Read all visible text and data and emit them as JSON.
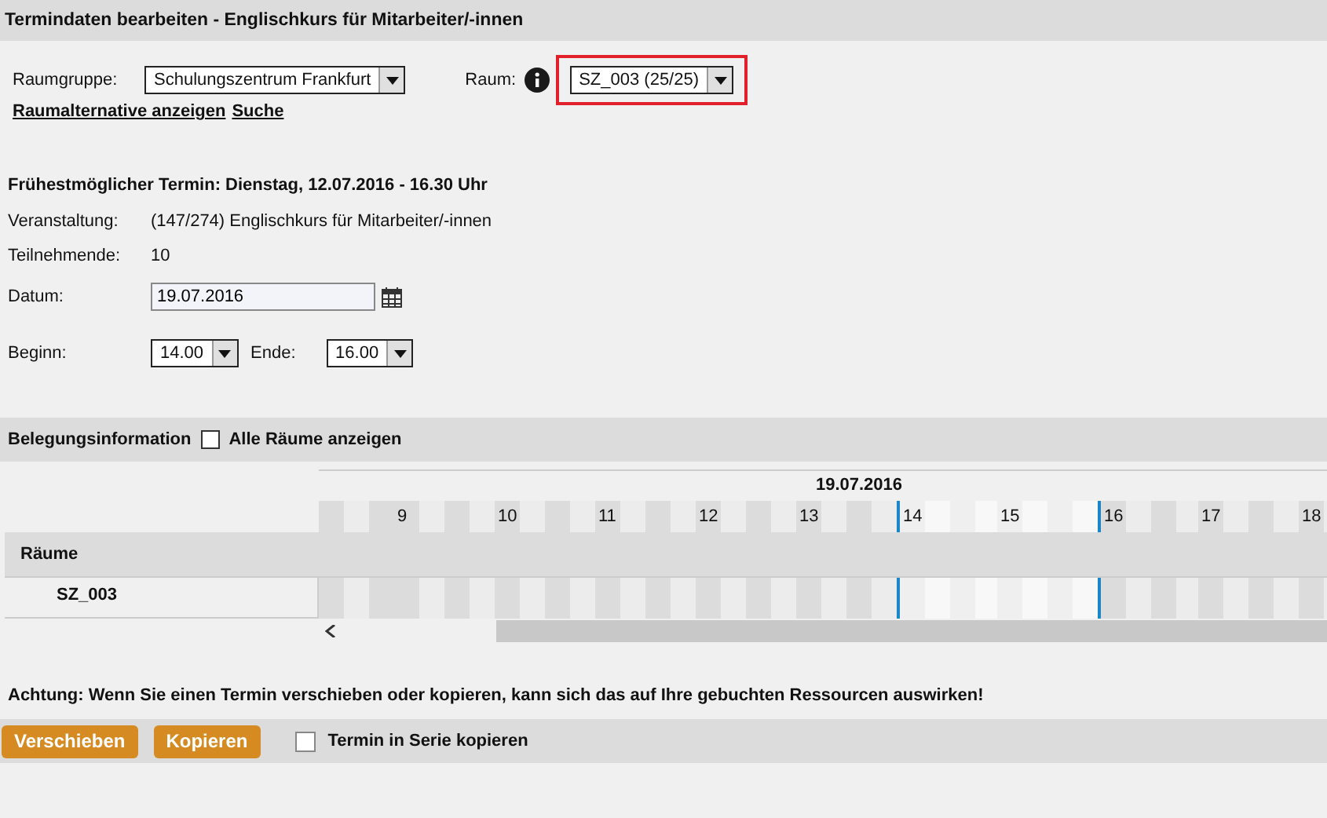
{
  "window": {
    "title": "Termindaten bearbeiten - Englischkurs für Mitarbeiter/-innen"
  },
  "room_group": {
    "label": "Raumgruppe:",
    "value": "Schulungszentrum Frankfurt"
  },
  "room": {
    "label": "Raum:",
    "value": "SZ_003 (25/25)",
    "highlighted": true
  },
  "links": [
    "Raumalternative anzeigen",
    "Suche"
  ],
  "earliest": "Frühestmöglicher Termin: Dienstag, 12.07.2016 - 16.30 Uhr",
  "details": [
    {
      "label": "Veranstaltung:",
      "value": "(147/274) Englischkurs für Mitarbeiter/-innen"
    },
    {
      "label": "Teilnehmende:",
      "value": "10"
    }
  ],
  "date": {
    "label": "Datum:",
    "value": "19.07.2016"
  },
  "begin": {
    "label": "Beginn:",
    "value": "14.00"
  },
  "end": {
    "label": "Ende:",
    "value": "16.00"
  },
  "occupancy": {
    "title": "Belegungsinformation",
    "checkbox": {
      "label": "Alle Räume anzeigen",
      "checked": false
    }
  },
  "timeline": {
    "date": "19.07.2016",
    "rooms_header": "Räume",
    "hours": [
      {
        "label": "9",
        "selected": false
      },
      {
        "label": "10",
        "selected": false
      },
      {
        "label": "11",
        "selected": false
      },
      {
        "label": "12",
        "selected": false
      },
      {
        "label": "13",
        "selected": false
      },
      {
        "label": "14",
        "selected": true
      },
      {
        "label": "15",
        "selected": true
      },
      {
        "label": "16",
        "selected": false
      },
      {
        "label": "17",
        "selected": false
      },
      {
        "label": "18",
        "selected": false
      }
    ],
    "rooms": [
      "SZ_003"
    ]
  },
  "warning": "Achtung: Wenn Sie einen Termin verschieben oder kopieren, kann sich das auf Ihre gebuchten Ressourcen auswirken!",
  "buttons": [
    "Verschieben",
    "Kopieren"
  ],
  "series": {
    "label": "Termin in Serie kopieren",
    "checked": false
  }
}
